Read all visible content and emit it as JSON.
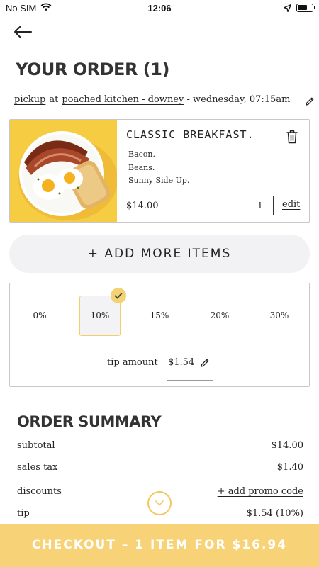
{
  "status_bar": {
    "carrier": "No SIM",
    "time": "12:06"
  },
  "page": {
    "title": "YOUR ORDER (1)"
  },
  "pickup": {
    "mode": "pickup",
    "at": "at",
    "location": "poached kitchen - downey",
    "datetime": "- wednesday, 07:15am"
  },
  "item": {
    "name": "CLASSIC BREAKFAST.",
    "options": [
      "Bacon.",
      "Beans.",
      "Sunny Side Up."
    ],
    "price": "$14.00",
    "quantity": "1",
    "edit_label": "edit"
  },
  "add_more_label": "+ ADD MORE ITEMS",
  "tip": {
    "options": [
      "0%",
      "10%",
      "15%",
      "20%",
      "30%"
    ],
    "selected": "10%",
    "amount_label": "tip amount",
    "amount_value": "$1.54"
  },
  "summary": {
    "title": "ORDER SUMMARY",
    "rows": [
      {
        "label": "subtotal",
        "value": "$14.00"
      },
      {
        "label": "sales tax",
        "value": "$1.40"
      },
      {
        "label": "discounts",
        "value": "+ add promo code"
      },
      {
        "label": "tip",
        "value": "$1.54 (10%)"
      }
    ]
  },
  "checkout_label": "CHECKOUT – 1 ITEM FOR $16.94",
  "colors": {
    "accent": "#f7d277",
    "accent_border": "#f2c85b",
    "button_bg": "#f2f2f4",
    "image_bg": "#f6cd42"
  }
}
